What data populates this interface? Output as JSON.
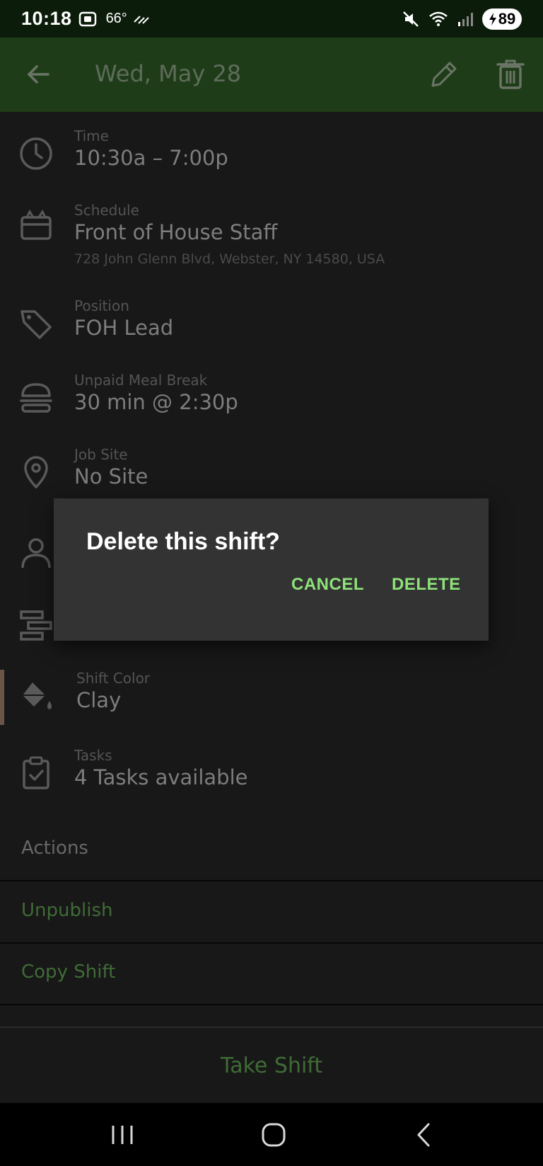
{
  "status_bar": {
    "time": "10:18",
    "temperature": "66°",
    "battery": "89"
  },
  "app_bar": {
    "title": "Wed, May 28"
  },
  "details": {
    "time": {
      "label": "Time",
      "value": "10:30a – 7:00p"
    },
    "schedule": {
      "label": "Schedule",
      "value": "Front of House Staff",
      "address": "728 John Glenn Blvd, Webster, NY 14580, USA"
    },
    "position": {
      "label": "Position",
      "value": "FOH Lead"
    },
    "meal_break": {
      "label": "Unpaid Meal Break",
      "value": "30 min @ 2:30p"
    },
    "job_site": {
      "label": "Job Site",
      "value": "No Site"
    },
    "shift_color": {
      "label": "Shift Color",
      "value": "Clay"
    },
    "tasks": {
      "label": "Tasks",
      "value": "4 Tasks available"
    }
  },
  "actions": {
    "header": "Actions",
    "unpublish": "Unpublish",
    "copy_shift": "Copy Shift",
    "take_shift": "Take Shift"
  },
  "dialog": {
    "title": "Delete this shift?",
    "cancel": "CANCEL",
    "delete": "DELETE"
  },
  "colors": {
    "app_bar": "#1f3c18",
    "accent": "#8ee27a",
    "action_text": "#3f6b36",
    "shift_color_clay": "#6b5448"
  }
}
